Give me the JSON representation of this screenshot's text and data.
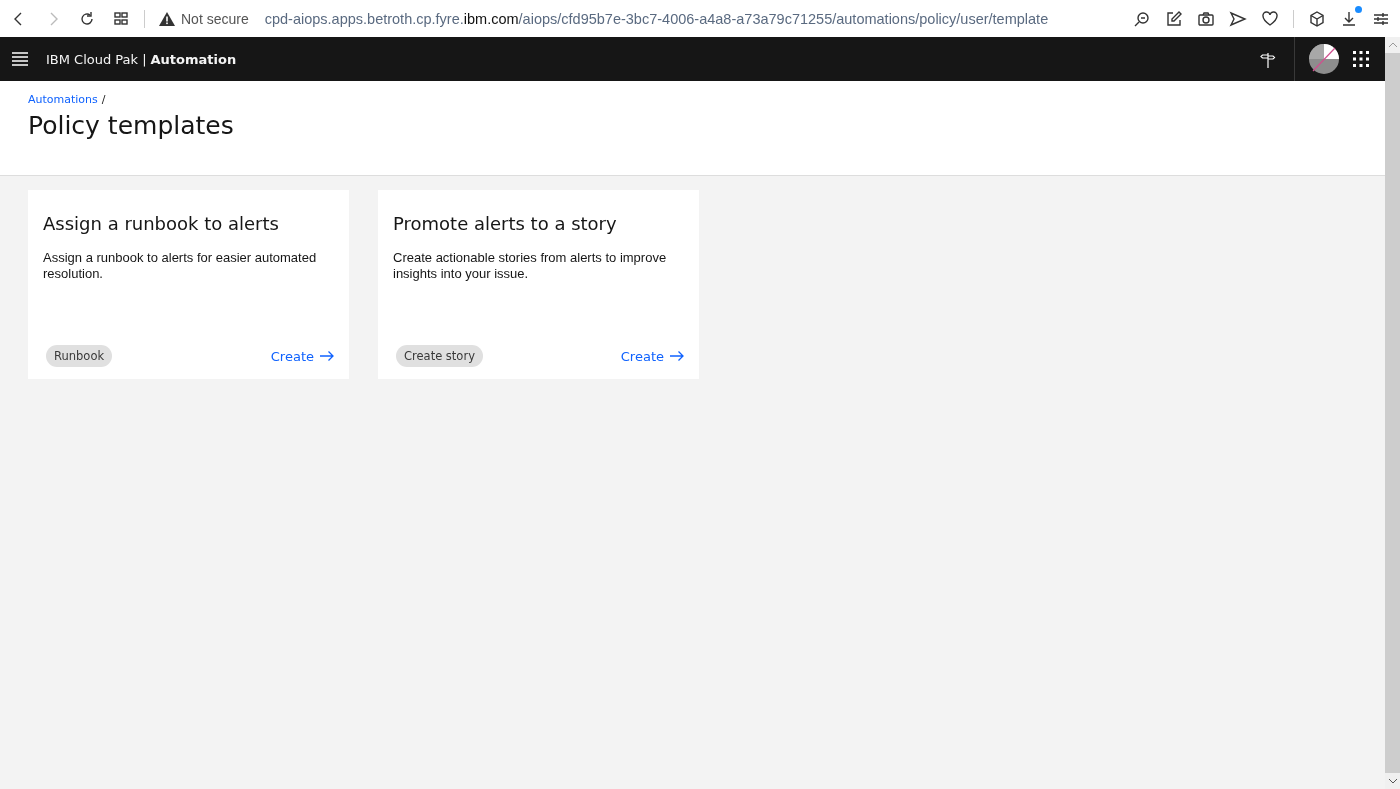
{
  "browser": {
    "security": "Not secure",
    "url": {
      "before": "cpd-aiops.apps.betroth.cp.fyre.",
      "domain": "ibm.com",
      "after": "/aiops/cfd95b7e-3bc7-4006-a4a8-a73a79c71255/automations/policy/user/template"
    },
    "download_badge": true
  },
  "header": {
    "product": "IBM Cloud Pak",
    "separator": "|",
    "product_bold": "Automation"
  },
  "breadcrumb": [
    {
      "label": "Automations",
      "separator": "/"
    }
  ],
  "page_title": "Policy templates",
  "cards": [
    {
      "title": "Assign a runbook to alerts",
      "description": "Assign a runbook to alerts for easier automated resolution.",
      "tag": "Runbook",
      "action": "Create"
    },
    {
      "title": "Promote alerts to a story",
      "description": "Create actionable stories from alerts to improve insights into your issue.",
      "tag": "Create story",
      "action": "Create"
    }
  ]
}
